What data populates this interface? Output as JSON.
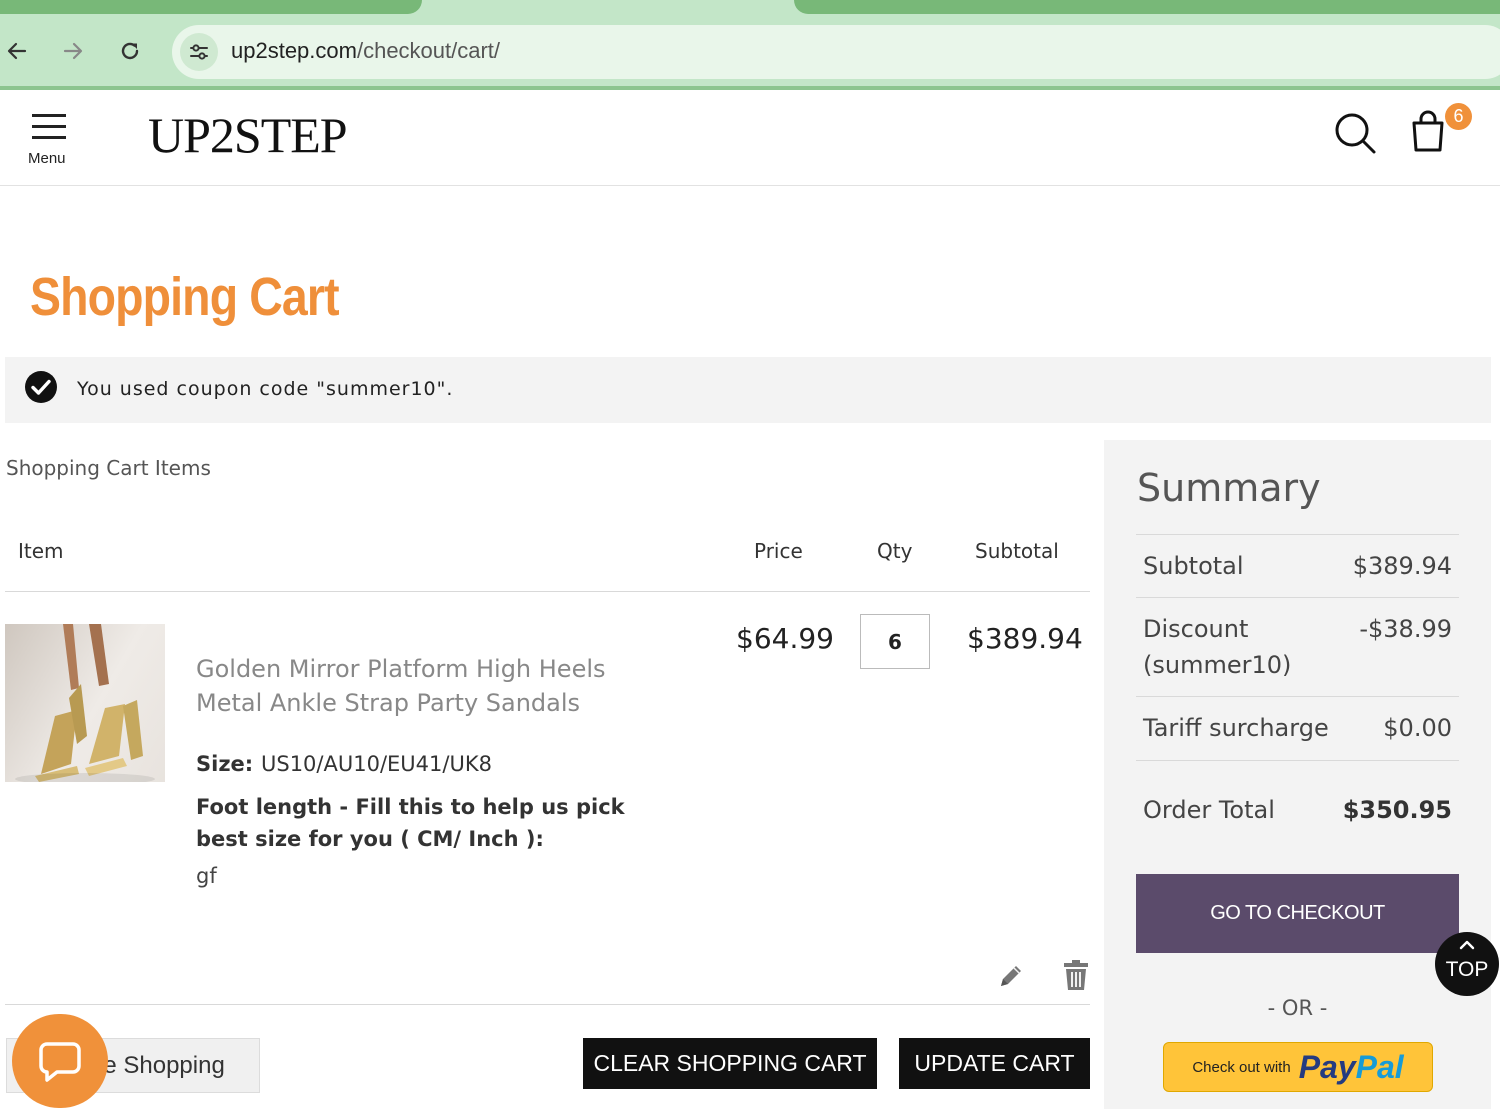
{
  "browser": {
    "url_domain": "up2step.com",
    "url_path": "/checkout/cart/",
    "icons": [
      "back-icon",
      "forward-icon",
      "reload-icon",
      "site-info-icon"
    ]
  },
  "header": {
    "menu_label": "Menu",
    "logo": "UP2STEP",
    "cart_count": "6",
    "icons": [
      "hamburger-icon",
      "search-icon",
      "bag-icon"
    ]
  },
  "page": {
    "title": "Shopping Cart",
    "notice": "You used coupon code \"summer10\".",
    "items_caption": "Shopping Cart Items"
  },
  "cart": {
    "columns": {
      "item": "Item",
      "price": "Price",
      "qty": "Qty",
      "subtotal": "Subtotal"
    },
    "items": [
      {
        "name": "Golden Mirror Platform High Heels Metal Ankle Strap Party Sandals",
        "price": "$64.99",
        "qty": "6",
        "subtotal": "$389.94",
        "options": [
          {
            "label": "Size:",
            "value": "US10/AU10/EU41/UK8"
          },
          {
            "label": "Foot length - Fill this to help us pick best size for you ( CM/ Inch ):",
            "value": "gf"
          }
        ]
      }
    ],
    "actions": {
      "continue_partial": "ue Shopping",
      "clear": "CLEAR SHOPPING CART",
      "update": "UPDATE CART"
    }
  },
  "summary": {
    "title": "Summary",
    "rows": [
      {
        "label": "Subtotal",
        "value": "$389.94"
      },
      {
        "label": "Discount (summer10)",
        "value": "-$38.99"
      },
      {
        "label": "Tariff surcharge",
        "value": "$0.00"
      }
    ],
    "total_label": "Order Total",
    "total_value": "$350.95",
    "checkout_label": "GO TO CHECKOUT",
    "or_label": "- OR -",
    "paypal_prefix": "Check out with",
    "paypal_pay": "Pay",
    "paypal_pal": "Pal"
  },
  "scroll_top_label": "TOP",
  "colors": {
    "accent": "#ef8f3a",
    "checkout": "#5b4b6b",
    "paypal": "#ffc439",
    "chrome": "#c3e6c8"
  }
}
